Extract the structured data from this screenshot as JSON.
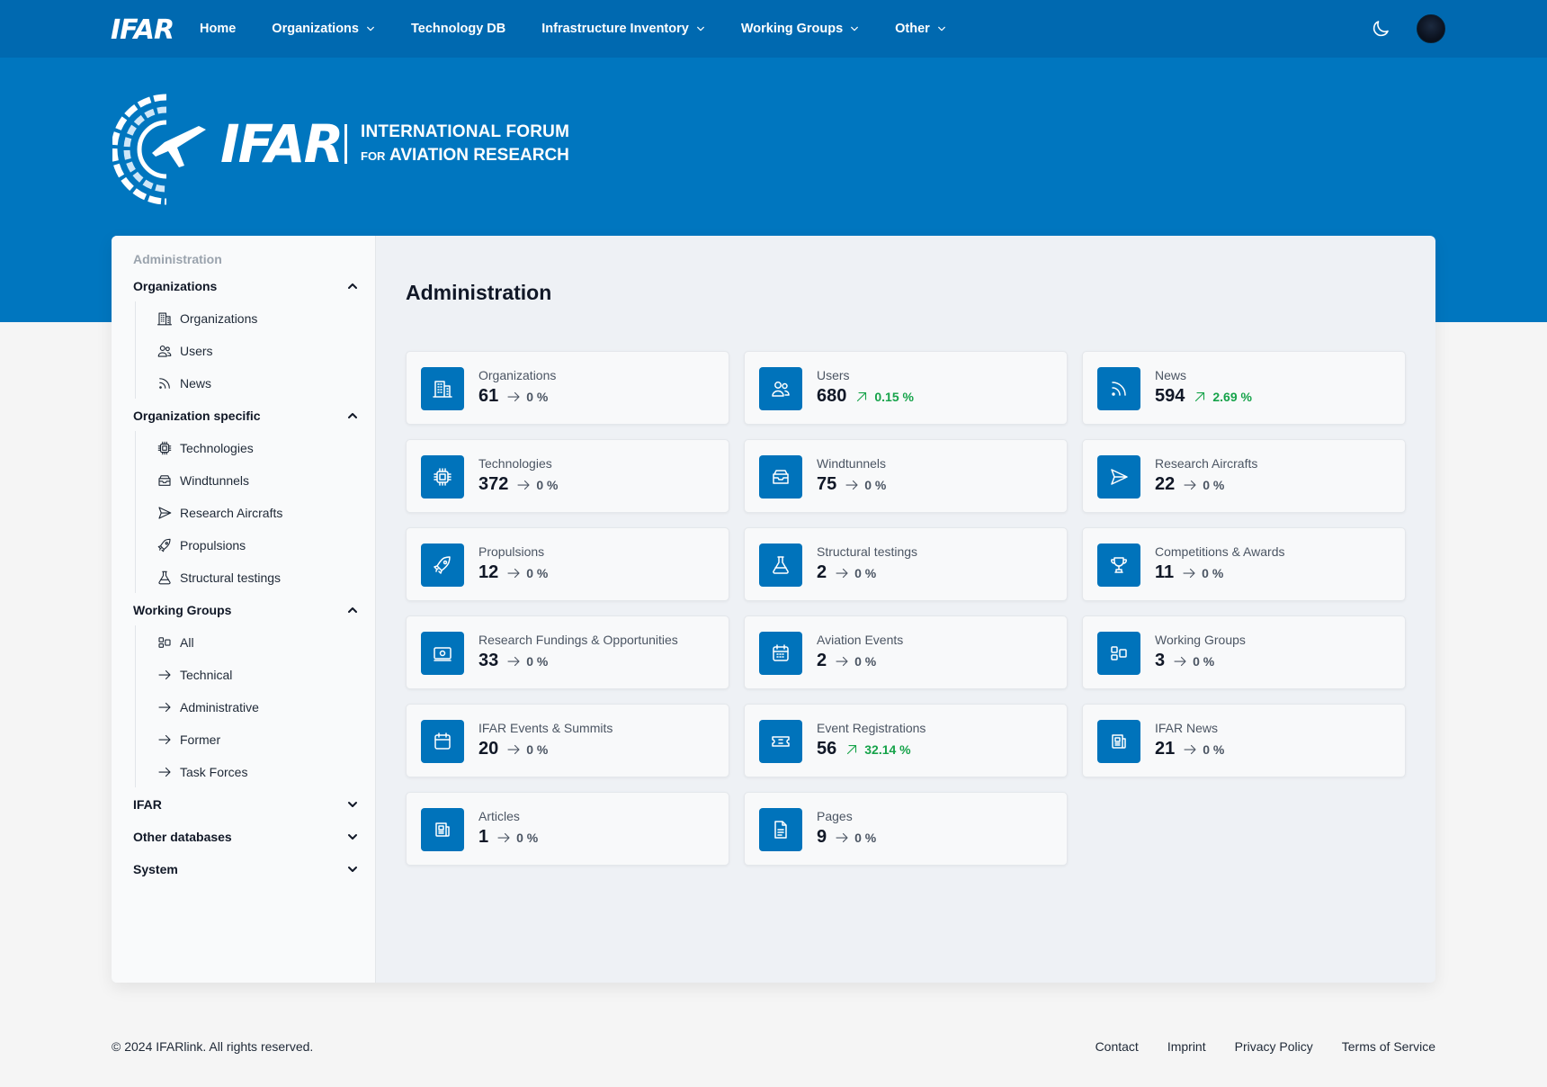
{
  "nav": {
    "logo": "IFAR",
    "items": [
      {
        "label": "Home",
        "dropdown": false
      },
      {
        "label": "Organizations",
        "dropdown": true
      },
      {
        "label": "Technology DB",
        "dropdown": false
      },
      {
        "label": "Infrastructure Inventory",
        "dropdown": true
      },
      {
        "label": "Working Groups",
        "dropdown": true
      },
      {
        "label": "Other",
        "dropdown": true
      }
    ]
  },
  "hero": {
    "brand_word": "IFAR",
    "line1": "INTERNATIONAL FORUM",
    "line2_small": "FOR",
    "line2": "AVIATION RESEARCH"
  },
  "sidebar": {
    "caption": "Administration",
    "groups": [
      {
        "label": "Organizations",
        "expanded": true,
        "items": [
          {
            "label": "Organizations",
            "icon": "building-icon"
          },
          {
            "label": "Users",
            "icon": "users-icon"
          },
          {
            "label": "News",
            "icon": "rss-icon"
          }
        ]
      },
      {
        "label": "Organization specific",
        "expanded": true,
        "items": [
          {
            "label": "Technologies",
            "icon": "chip-icon"
          },
          {
            "label": "Windtunnels",
            "icon": "inbox-stack-icon"
          },
          {
            "label": "Research Aircrafts",
            "icon": "paper-plane-icon"
          },
          {
            "label": "Propulsions",
            "icon": "rocket-icon"
          },
          {
            "label": "Structural testings",
            "icon": "flask-icon"
          }
        ]
      },
      {
        "label": "Working Groups",
        "expanded": true,
        "items": [
          {
            "label": "All",
            "icon": "squares-icon"
          },
          {
            "label": "Technical",
            "icon": "arrow-right-icon"
          },
          {
            "label": "Administrative",
            "icon": "arrow-right-icon"
          },
          {
            "label": "Former",
            "icon": "arrow-right-icon"
          },
          {
            "label": "Task Forces",
            "icon": "arrow-right-icon"
          }
        ]
      },
      {
        "label": "IFAR",
        "expanded": false,
        "items": []
      },
      {
        "label": "Other databases",
        "expanded": false,
        "items": []
      },
      {
        "label": "System",
        "expanded": false,
        "items": []
      }
    ]
  },
  "main": {
    "title": "Administration",
    "stats": [
      {
        "label": "Organizations",
        "value": "61",
        "change": "0 %",
        "trend": "flat",
        "icon": "building-icon"
      },
      {
        "label": "Users",
        "value": "680",
        "change": "0.15 %",
        "trend": "up",
        "icon": "users-icon"
      },
      {
        "label": "News",
        "value": "594",
        "change": "2.69 %",
        "trend": "up",
        "icon": "rss-icon"
      },
      {
        "label": "Technologies",
        "value": "372",
        "change": "0 %",
        "trend": "flat",
        "icon": "chip-icon"
      },
      {
        "label": "Windtunnels",
        "value": "75",
        "change": "0 %",
        "trend": "flat",
        "icon": "inbox-stack-icon"
      },
      {
        "label": "Research Aircrafts",
        "value": "22",
        "change": "0 %",
        "trend": "flat",
        "icon": "paper-plane-icon"
      },
      {
        "label": "Propulsions",
        "value": "12",
        "change": "0 %",
        "trend": "flat",
        "icon": "rocket-icon"
      },
      {
        "label": "Structural testings",
        "value": "2",
        "change": "0 %",
        "trend": "flat",
        "icon": "flask-icon"
      },
      {
        "label": "Competitions & Awards",
        "value": "11",
        "change": "0 %",
        "trend": "flat",
        "icon": "trophy-icon"
      },
      {
        "label": "Research Fundings & Opportunities",
        "value": "33",
        "change": "0 %",
        "trend": "flat",
        "icon": "banknote-icon"
      },
      {
        "label": "Aviation Events",
        "value": "2",
        "change": "0 %",
        "trend": "flat",
        "icon": "calendar-days-icon"
      },
      {
        "label": "Working Groups",
        "value": "3",
        "change": "0 %",
        "trend": "flat",
        "icon": "squares-icon"
      },
      {
        "label": "IFAR Events & Summits",
        "value": "20",
        "change": "0 %",
        "trend": "flat",
        "icon": "calendar-icon"
      },
      {
        "label": "Event Registrations",
        "value": "56",
        "change": "32.14 %",
        "trend": "up",
        "icon": "ticket-icon"
      },
      {
        "label": "IFAR News",
        "value": "21",
        "change": "0 %",
        "trend": "flat",
        "icon": "newspaper-icon"
      },
      {
        "label": "Articles",
        "value": "1",
        "change": "0 %",
        "trend": "flat",
        "icon": "newspaper-icon"
      },
      {
        "label": "Pages",
        "value": "9",
        "change": "0 %",
        "trend": "flat",
        "icon": "document-icon"
      }
    ]
  },
  "footer": {
    "copyright": "© 2024 IFARlink. All rights reserved.",
    "links": [
      "Contact",
      "Imprint",
      "Privacy Policy",
      "Terms of Service"
    ]
  }
}
